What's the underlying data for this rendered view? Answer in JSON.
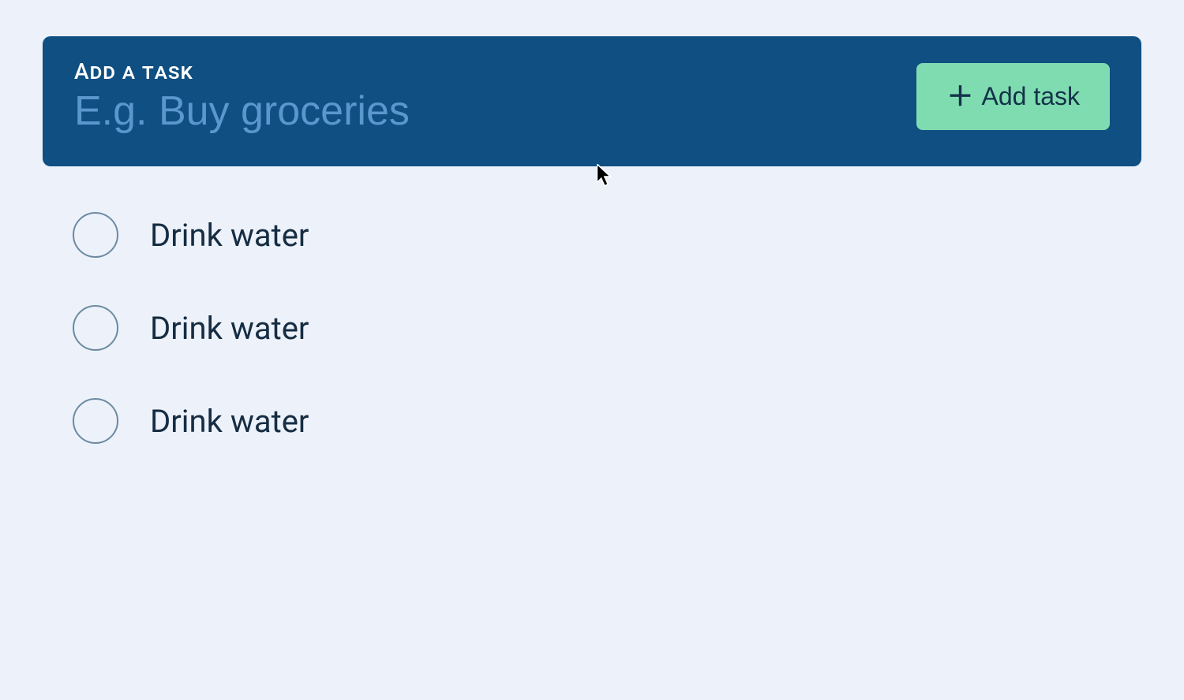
{
  "addPanel": {
    "label": "Add a task",
    "placeholder": "E.g. Buy groceries",
    "value": "",
    "buttonLabel": "Add task"
  },
  "tasks": [
    {
      "label": "Drink water",
      "done": false
    },
    {
      "label": "Drink water",
      "done": false
    },
    {
      "label": "Drink water",
      "done": false
    }
  ]
}
